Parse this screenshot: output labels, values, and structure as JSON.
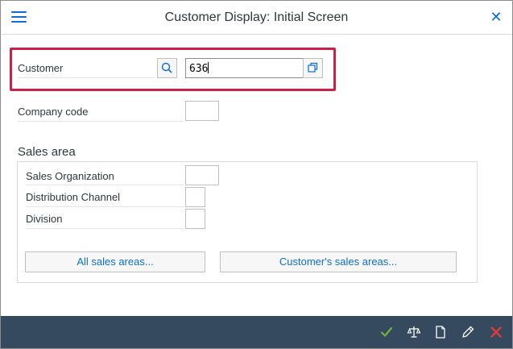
{
  "header": {
    "title": "Customer Display: Initial Screen",
    "menu_icon": "hamburger-menu-icon",
    "close_icon": "close-icon"
  },
  "form": {
    "customer_label": "Customer",
    "customer_value": "636",
    "company_code_label": "Company code",
    "company_code_value": ""
  },
  "sales_area": {
    "title": "Sales area",
    "sales_org_label": "Sales Organization",
    "sales_org_value": "",
    "distribution_channel_label": "Distribution Channel",
    "distribution_channel_value": "",
    "division_label": "Division",
    "division_value": "",
    "all_sales_areas_button": "All sales areas...",
    "customers_sales_areas_button": "Customer's sales areas..."
  },
  "footer": {
    "icons": [
      "check-icon",
      "balance-icon",
      "document-icon",
      "pencil-icon",
      "cancel-icon"
    ]
  },
  "colors": {
    "accent": "#0a6ed1",
    "highlight": "#c8224a",
    "footer_bg": "#354a5f",
    "check": "#6fb33b",
    "cancel": "#e03a3a"
  }
}
